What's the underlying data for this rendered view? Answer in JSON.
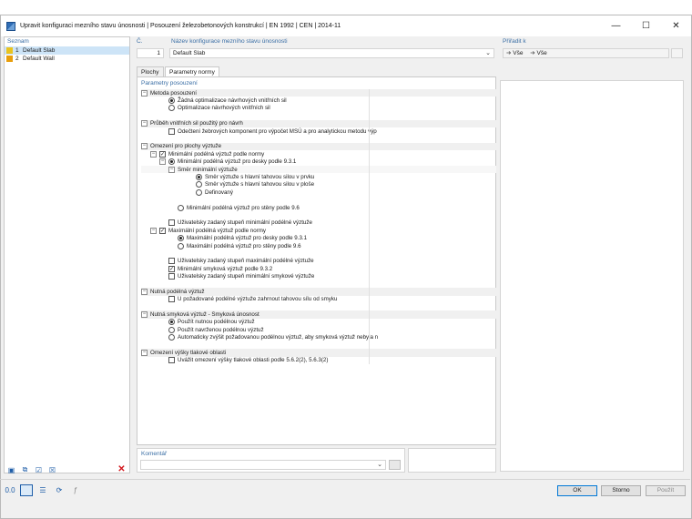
{
  "window": {
    "title": "Upravit konfiguraci mezního stavu únosnosti | Posouzení železobetonových konstrukcí | EN 1992 | CEN | 2014-11",
    "minimize": "—",
    "maximize": "☐",
    "close": "✕"
  },
  "list": {
    "header": "Seznam",
    "items": [
      {
        "num": "1",
        "name": "Default Slab",
        "color": "#e9c31e"
      },
      {
        "num": "2",
        "name": "Default Wall",
        "color": "#e89e0c"
      }
    ]
  },
  "config": {
    "num_label": "Č.",
    "num_value": "1",
    "name_label": "Název konfigurace mezního stavu únosnosti",
    "name_value": "Default Slab",
    "assign_label": "Přiřadit k",
    "assign_value": "Vše",
    "assign_value2": "Vše"
  },
  "tabs": [
    "Plochy",
    "Parametry normy"
  ],
  "params": {
    "header": "Parametry posouzení",
    "rows": [
      {
        "type": "section",
        "indent": 0,
        "exp": "−",
        "text": "Metoda posouzení"
      },
      {
        "type": "row",
        "indent": 2,
        "ctrl": "rb-on",
        "text": "Žádná optimalizace návrhových vnitřních sil"
      },
      {
        "type": "row",
        "indent": 2,
        "ctrl": "rb",
        "text": "Optimalizace návrhových vnitřních sil"
      },
      {
        "type": "blank"
      },
      {
        "type": "section",
        "indent": 0,
        "exp": "−",
        "text": "Průběh vnitřních sil použitý pro návrh"
      },
      {
        "type": "row",
        "indent": 2,
        "ctrl": "cb",
        "text": "Odečtení žebrových komponent pro výpočet MSÚ a pro analytickou metodu výp"
      },
      {
        "type": "blank"
      },
      {
        "type": "section",
        "indent": 0,
        "exp": "−",
        "text": "Omezení pro plochy výztuže"
      },
      {
        "type": "row",
        "indent": 1,
        "exp": "−",
        "ctrl": "cb-on",
        "text": "Minimální podélná výztuž podle normy"
      },
      {
        "type": "row",
        "indent": 2,
        "exp": "−",
        "ctrl": "rb-on",
        "text": "Minimální podélná výztuž pro desky podle 9.3.1"
      },
      {
        "type": "sub",
        "indent": 3,
        "exp": "−",
        "text": "Směr minimální výztuže"
      },
      {
        "type": "row",
        "indent": 5,
        "ctrl": "rb-on",
        "text": "Směr výztuže s hlavní tahovou silou v prvku"
      },
      {
        "type": "row",
        "indent": 5,
        "ctrl": "rb",
        "text": "Směr výztuže s hlavní tahovou silou v ploše"
      },
      {
        "type": "row",
        "indent": 5,
        "ctrl": "rb",
        "text": "Definovaný"
      },
      {
        "type": "blank"
      },
      {
        "type": "row",
        "indent": 3,
        "ctrl": "rb",
        "text": "Minimální podélná výztuž pro stěny podle 9.6"
      },
      {
        "type": "blank"
      },
      {
        "type": "row",
        "indent": 2,
        "ctrl": "cb",
        "text": "Uživatelsky zadaný stupeň minimální podélné výztuže"
      },
      {
        "type": "row",
        "indent": 1,
        "exp": "−",
        "ctrl": "cb-on",
        "text": "Maximální podélná výztuž podle normy"
      },
      {
        "type": "row",
        "indent": 3,
        "ctrl": "rb-on",
        "text": "Maximální podélná výztuž pro desky podle 9.3.1"
      },
      {
        "type": "row",
        "indent": 3,
        "ctrl": "rb",
        "text": "Maximální podélná výztuž pro stěny podle 9.6"
      },
      {
        "type": "blank"
      },
      {
        "type": "row",
        "indent": 2,
        "ctrl": "cb",
        "text": "Uživatelsky zadaný stupeň maximální podélné výztuže"
      },
      {
        "type": "row",
        "indent": 2,
        "ctrl": "cb-on",
        "text": "Minimální smyková výztuž podle 9.3.2"
      },
      {
        "type": "row",
        "indent": 2,
        "ctrl": "cb",
        "text": "Uživatelsky zadaný stupeň minimální smykové výztuže"
      },
      {
        "type": "blank"
      },
      {
        "type": "section",
        "indent": 0,
        "exp": "−",
        "text": "Nutná podélná výztuž"
      },
      {
        "type": "row",
        "indent": 2,
        "ctrl": "cb",
        "text": "U požadované podélné výztuže zahrnout tahovou sílu od smyku"
      },
      {
        "type": "blank"
      },
      {
        "type": "section",
        "indent": 0,
        "exp": "−",
        "text": "Nutná smyková výztuž - Smyková únosnost"
      },
      {
        "type": "row",
        "indent": 2,
        "ctrl": "rb-on",
        "text": "Použít nutnou podélnou výztuž"
      },
      {
        "type": "row",
        "indent": 2,
        "ctrl": "rb",
        "text": "Použít navrženou podélnou výztuž"
      },
      {
        "type": "row",
        "indent": 2,
        "ctrl": "rb",
        "text": "Automaticky zvýšit požadovanou podélnou výztuž, aby smyková výztuž nebyla n"
      },
      {
        "type": "blank"
      },
      {
        "type": "section",
        "indent": 0,
        "exp": "−",
        "text": "Omezení výšky tlakové oblasti"
      },
      {
        "type": "row",
        "indent": 2,
        "ctrl": "cb",
        "text": "Uvážit omezení výšky tlakové oblasti podle 5.6.2(2), 5.6.3(2)"
      }
    ]
  },
  "comment": {
    "label": "Komentář"
  },
  "buttons": {
    "ok": "OK",
    "cancel": "Storno",
    "apply": "Použít"
  }
}
